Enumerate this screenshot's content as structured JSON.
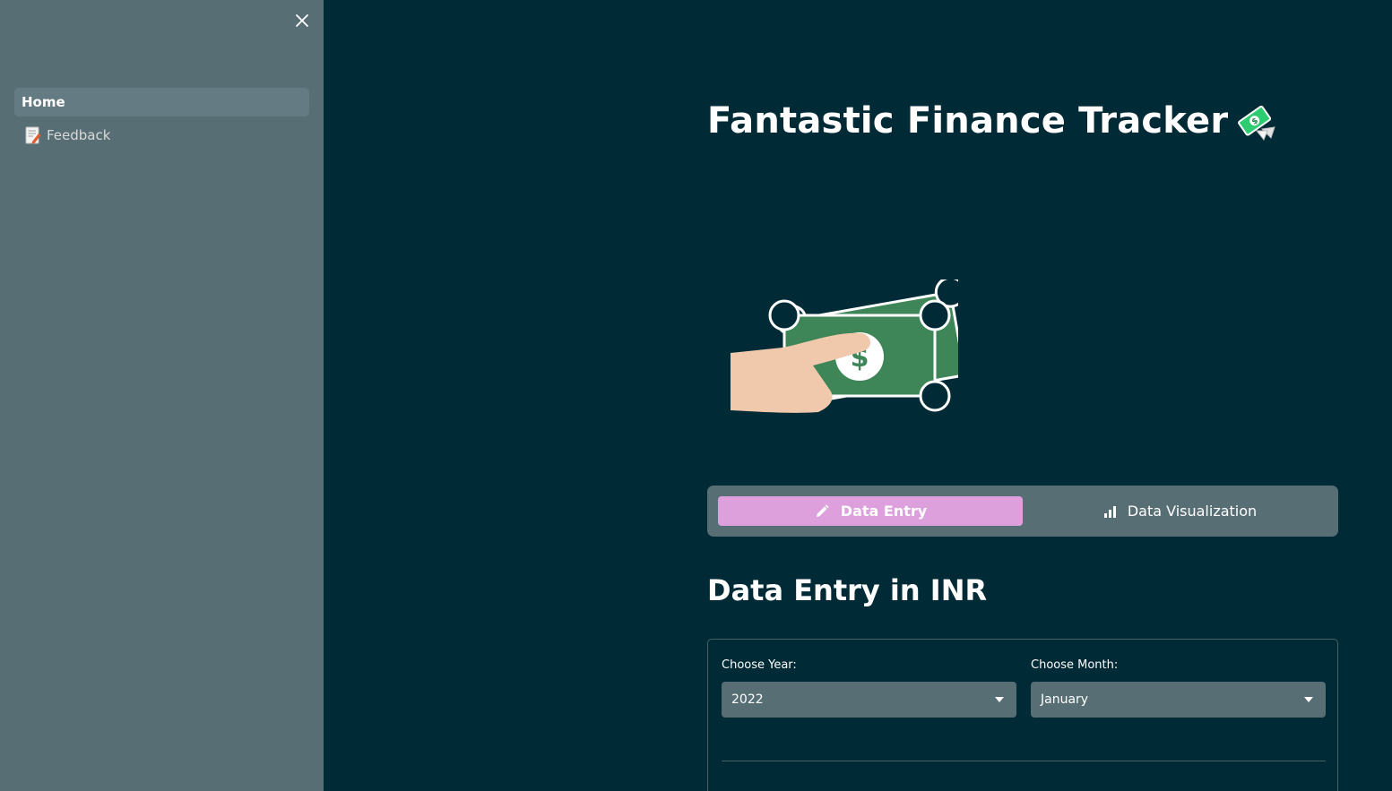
{
  "sidebar": {
    "items": [
      {
        "label": "Home",
        "icon": null,
        "active": true
      },
      {
        "label": "Feedback",
        "icon": "memo-icon",
        "active": false
      }
    ]
  },
  "page": {
    "title": "Fantastic Finance Tracker",
    "title_icon": "money-with-wings-icon",
    "hero_image": "hand-holding-cash-icon"
  },
  "tabs": [
    {
      "label": "Data Entry",
      "icon": "pencil-icon",
      "selected": true
    },
    {
      "label": "Data Visualization",
      "icon": "bar-chart-icon",
      "selected": false
    }
  ],
  "section": {
    "heading": "Data Entry in INR"
  },
  "form": {
    "year": {
      "label": "Choose Year:",
      "value": "2022"
    },
    "month": {
      "label": "Choose Month:",
      "value": "January"
    }
  },
  "colors": {
    "background": "#002b36",
    "sidebar": "#586e75",
    "accent": "#dda0dd",
    "cash_green": "#3e8658",
    "skin": "#f0c9ad"
  }
}
